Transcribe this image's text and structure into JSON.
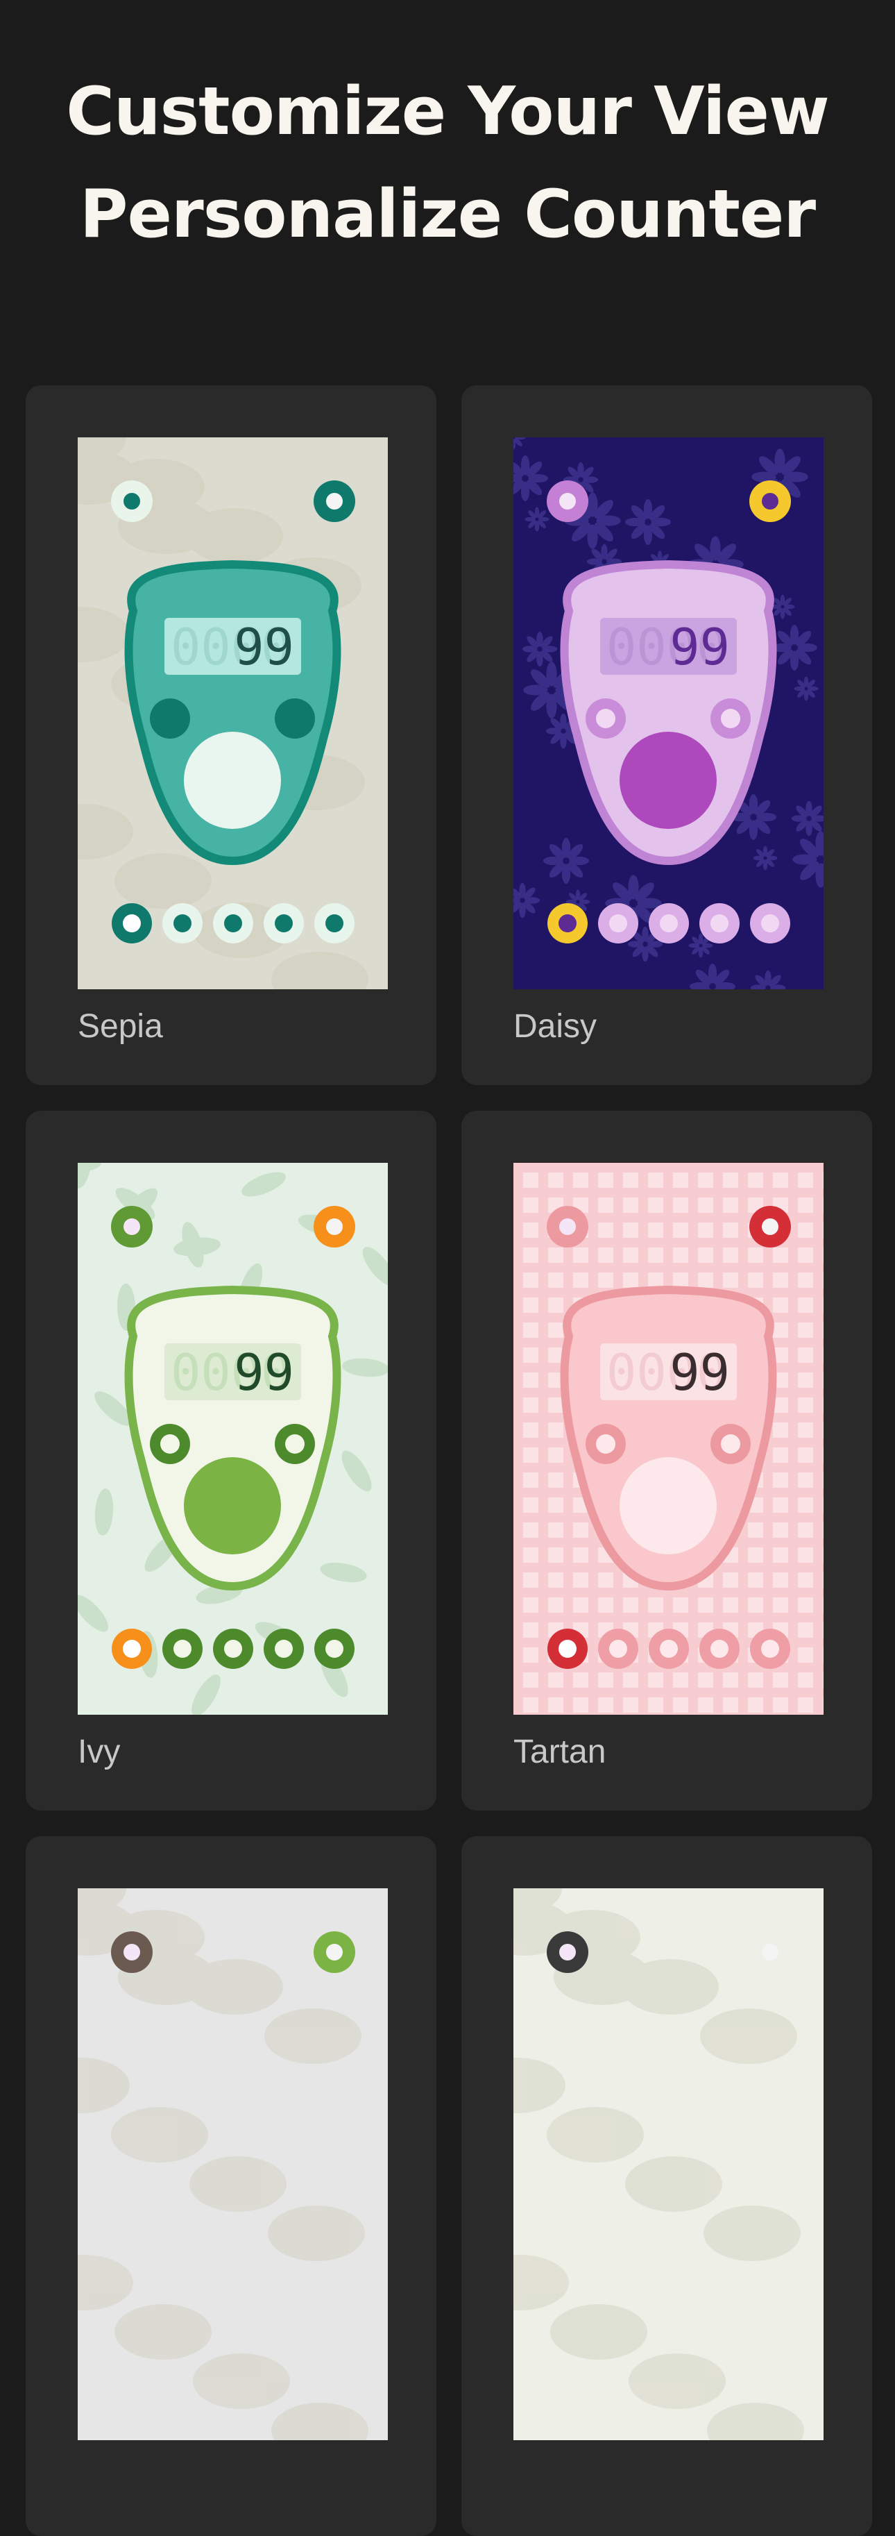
{
  "header": {
    "line1": "Customize Your View",
    "line2": "Personalize Counter"
  },
  "themes": [
    {
      "name": "Sepia",
      "display": "99",
      "colors": {
        "background": "#dcdbcf",
        "body": "#47b3a5",
        "rim": "#138978",
        "screen": "#b5e7e1",
        "digit": "#1f4f46",
        "digit_ghost": "#9fd7cf",
        "button": "#e9f6ef",
        "accent": "#0f7a6c",
        "dot": "#e7f5ec",
        "dot_center": "#0f7a6c",
        "top_left": "#e9f4ea",
        "top_right": "#0f7a6c",
        "active": "#0f7a6c"
      }
    },
    {
      "name": "Daisy",
      "display": "99",
      "colors": {
        "background": "#1f1564",
        "body": "#e3c2eb",
        "rim": "#c084d5",
        "screen": "#c9a4e0",
        "digit": "#5e2a94",
        "digit_ghost": "#b995d6",
        "button": "#ad49bd",
        "accent": "#c98cd8",
        "dot": "#dcaee8",
        "dot_center": "#f1d9f4",
        "top_left": "#c480d4",
        "top_right": "#f5c92e",
        "active": "#f5c92e"
      }
    },
    {
      "name": "Ivy",
      "display": "99",
      "colors": {
        "background": "#e4efe6",
        "body": "#f1f6e9",
        "rim": "#78b449",
        "screen": "#dcebd2",
        "digit": "#214a2b",
        "digit_ghost": "#c5dfba",
        "button": "#7bb344",
        "accent": "#4d8a2c",
        "dot": "#4d8a2c",
        "dot_center": "#f1f6e9",
        "top_left": "#5f9a35",
        "top_right": "#f6901a",
        "active": "#f6901a"
      }
    },
    {
      "name": "Tartan",
      "display": "99",
      "colors": {
        "background": "#fbe2e5",
        "body": "#f9c7cc",
        "rim": "#ec9aa0",
        "screen": "#fbe2e4",
        "digit": "#3a2d30",
        "digit_ghost": "#f2ccd1",
        "button": "#fde9eb",
        "accent": "#ec9aa0",
        "dot": "#ef9ea5",
        "dot_center": "#fde9eb",
        "top_left": "#ec9aa0",
        "top_right": "#d42e36",
        "active": "#d42e36"
      }
    },
    {
      "name": "",
      "display": "",
      "colors": {
        "background": "#e6e6e6",
        "top_left": "#6b5a50",
        "top_right": "#7bb344"
      }
    },
    {
      "name": "",
      "display": "",
      "colors": {
        "background": "#eef0e8",
        "top_left": "#3a3a3a",
        "top_right": "#eef0e8"
      }
    }
  ]
}
